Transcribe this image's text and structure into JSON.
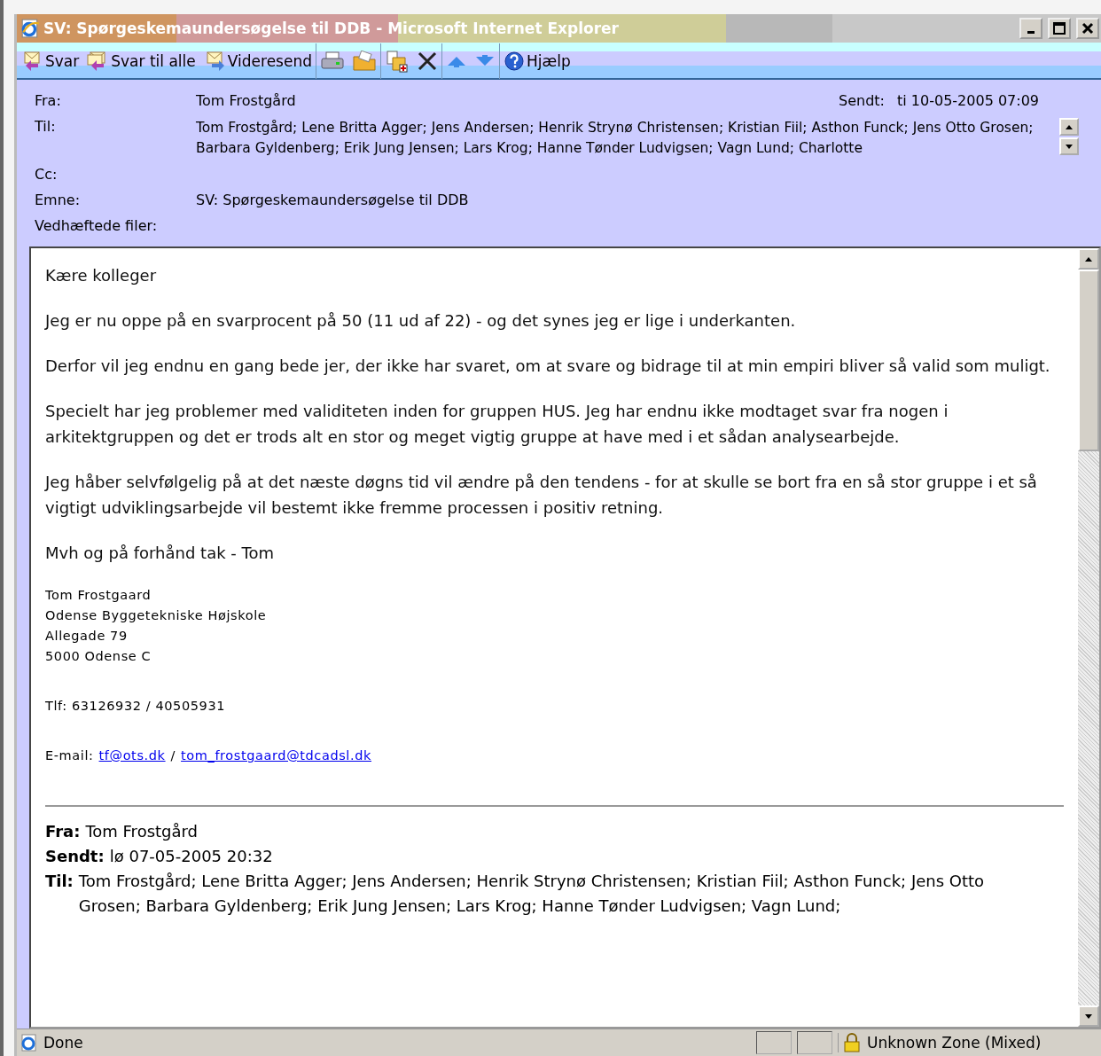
{
  "window": {
    "title": "SV: Spørgeskemaundersøgelse til DDB - Microsoft Internet Explorer"
  },
  "toolbar": [
    {
      "kind": "reply",
      "label": "Svar"
    },
    {
      "kind": "replyall",
      "label": "Svar til alle"
    },
    {
      "kind": "forward",
      "label": "Videresend"
    },
    {
      "kind": "print"
    },
    {
      "kind": "folder"
    },
    {
      "kind": "move"
    },
    {
      "kind": "delete"
    },
    {
      "kind": "up"
    },
    {
      "kind": "down"
    },
    {
      "kind": "help",
      "label": "Hjælp"
    }
  ],
  "header": {
    "from": {
      "label": "Fra:",
      "value": "Tom Frostgård"
    },
    "sent": {
      "label": "Sendt:",
      "value": "ti 10-05-2005 07:09"
    },
    "to": {
      "label": "Til:",
      "value": "Tom Frostgård; Lene Britta Agger; Jens Andersen; Henrik Strynø Christensen; Kristian Fiil; Asthon Funck; Jens Otto Grosen; Barbara Gyldenberg; Erik Jung Jensen; Lars Krog; Hanne Tønder Ludvigsen; Vagn Lund; Charlotte"
    },
    "cc": {
      "label": "Cc:"
    },
    "subject": {
      "label": "Emne:",
      "value": "SV: Spørgeskemaundersøgelse til DDB"
    },
    "attachments": {
      "label": "Vedhæftede filer:"
    }
  },
  "body": {
    "paragraphs": [
      "Kære kolleger",
      "Jeg er nu oppe på en svarprocent på 50 (11 ud af 22) - og det synes jeg er lige i underkanten.",
      "Derfor vil jeg endnu en gang bede jer, der ikke har svaret, om at svare og bidrage til at min empiri bliver så valid som muligt.",
      "Specielt har jeg problemer med validiteten inden for gruppen HUS. Jeg har endnu ikke modtaget svar fra nogen i arkitektgruppen og det er trods alt en stor og meget vigtig gruppe at have med i et sådan analysearbejde.",
      "Jeg håber selvfølgelig på at det næste døgns tid vil ændre på den tendens - for at skulle se bort fra en så stor gruppe i et så vigtigt udviklingsarbejde vil bestemt ikke fremme processen i positiv retning.",
      "Mvh og på forhånd tak - Tom"
    ],
    "signature": [
      "Tom Frostgaard",
      "Odense Byggetekniske Højskole",
      "Allegade 79",
      "5000 Odense C"
    ],
    "phone": "Tlf: 63126932 / 40505931",
    "email": {
      "label": "E-mail:",
      "links": [
        "tf@ots.dk",
        "tom_frostgaard@tdcadsl.dk"
      ],
      "separator": "/"
    },
    "quoted": [
      {
        "label": "Fra:",
        "value": "Tom Frostgård"
      },
      {
        "label": "Sendt:",
        "value": "lø 07-05-2005 20:32"
      },
      {
        "label": "Til:",
        "value": "Tom Frostgård; Lene Britta Agger; Jens Andersen; Henrik Strynø Christensen; Kristian Fiil; Asthon Funck; Jens Otto Grosen; Barbara Gyldenberg; Erik Jung Jensen; Lars Krog; Hanne Tønder Ludvigsen; Vagn Lund;"
      }
    ]
  },
  "status_bar": {
    "text": "Done",
    "zone": "Unknown Zone (Mixed)"
  }
}
